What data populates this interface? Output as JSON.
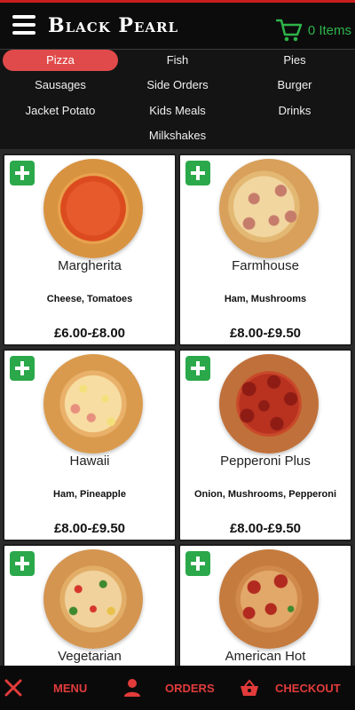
{
  "header": {
    "brand": "Black Pearl",
    "cart_label": "0 Items",
    "accent_color": "#c81d1d",
    "cart_color": "#2fb44a"
  },
  "categories": [
    {
      "label": "Pizza",
      "active": true
    },
    {
      "label": "Fish",
      "active": false
    },
    {
      "label": "Pies",
      "active": false
    },
    {
      "label": "Sausages",
      "active": false
    },
    {
      "label": "Side Orders",
      "active": false
    },
    {
      "label": "Burger",
      "active": false
    },
    {
      "label": "Jacket Potato",
      "active": false
    },
    {
      "label": "Kids Meals",
      "active": false
    },
    {
      "label": "Drinks",
      "active": false
    },
    {
      "label": "Milkshakes",
      "active": false
    }
  ],
  "products": [
    {
      "name": "Margherita",
      "desc": "Cheese, Tomatoes",
      "price": "£6.00-£8.00"
    },
    {
      "name": "Farmhouse",
      "desc": "Ham, Mushrooms",
      "price": "£8.00-£9.50"
    },
    {
      "name": "Hawaii",
      "desc": "Ham, Pineapple",
      "price": "£8.00-£9.50"
    },
    {
      "name": "Pepperoni Plus",
      "desc": "Onion, Mushrooms, Pepperoni",
      "price": "£8.00-£9.50"
    },
    {
      "name": "Vegetarian",
      "desc": "",
      "price": ""
    },
    {
      "name": "American Hot",
      "desc": "",
      "price": ""
    }
  ],
  "bottom_nav": {
    "menu": "MENU",
    "orders": "ORDERS",
    "checkout": "CHECKOUT"
  },
  "icons": {
    "menu": "hamburger-icon",
    "cart": "cart-icon",
    "nav_menu": "utensils-icon",
    "nav_orders": "user-icon",
    "nav_checkout": "basket-icon"
  }
}
